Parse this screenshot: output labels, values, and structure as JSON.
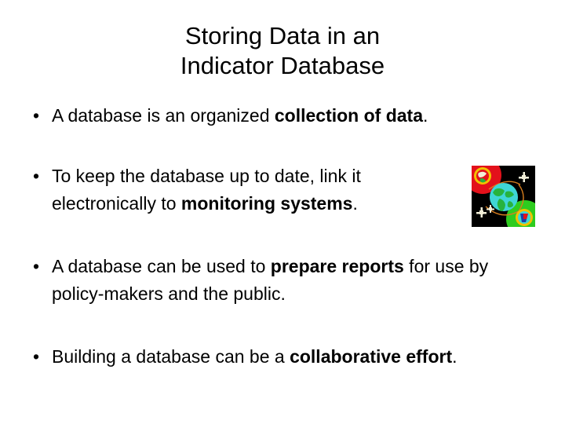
{
  "slide": {
    "background_color": "#ffffff",
    "text_color": "#000000",
    "title": {
      "line1": "Storing Data in an",
      "line2": "Indicator Database"
    },
    "bullets": [
      {
        "marker": "•",
        "segments": [
          {
            "text": "A database is an organized ",
            "bold": false
          },
          {
            "text": "collection of data",
            "bold": true
          },
          {
            "text": ".",
            "bold": false
          }
        ],
        "plain": "A database is an organized collection of data."
      },
      {
        "marker": "•",
        "segments": [
          {
            "text": "To keep the database up to date, link it electronically to ",
            "bold": false
          },
          {
            "text": "monitoring systems",
            "bold": true
          },
          {
            "text": ".",
            "bold": false
          }
        ],
        "plain": "To keep the database up to date, link it electronically to monitoring systems."
      },
      {
        "marker": "•",
        "segments": [
          {
            "text": "A database can be used to ",
            "bold": false
          },
          {
            "text": "prepare reports",
            "bold": true
          },
          {
            "text": " for use by policy-makers and the public.",
            "bold": false
          }
        ],
        "plain": "A database can be used to prepare reports for use by policy-makers and the public."
      },
      {
        "marker": "•",
        "segments": [
          {
            "text": "Building a database can be a ",
            "bold": false
          },
          {
            "text": "collaborative effort",
            "bold": true
          },
          {
            "text": ".",
            "bold": false
          }
        ],
        "plain": "Building a database can be a collaborative effort."
      }
    ],
    "picture": {
      "name": "global-monitoring-clipart",
      "description": "Black square clip-art showing a turquoise globe with green continents, a red circle at upper-left containing a monitoring icon, a green circle at lower-right containing an icon, and small cream satellite shapes connected by orange orbit lines.",
      "colors": {
        "background": "#000000",
        "globe_ocean": "#3fd6d6",
        "globe_land": "#27b33e",
        "red_circle": "#e3111b",
        "green_circle": "#2ecc1f",
        "orbit_line": "#d97f1e",
        "satellite": "#f2efd8",
        "accent_yellow": "#f2c200"
      }
    }
  }
}
